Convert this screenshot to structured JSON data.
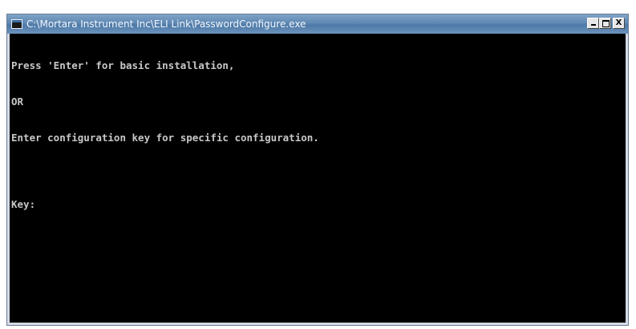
{
  "window": {
    "title": "C:\\Mortara Instrument Inc\\ELI Link\\PasswordConfigure.exe",
    "icon": "console-app-icon",
    "controls": {
      "minimize_label": "_",
      "maximize_label": "",
      "close_label": "X"
    }
  },
  "console": {
    "lines": [
      "Press 'Enter' for basic installation,",
      "OR",
      "Enter configuration key for specific configuration.",
      "",
      "Key:"
    ]
  }
}
